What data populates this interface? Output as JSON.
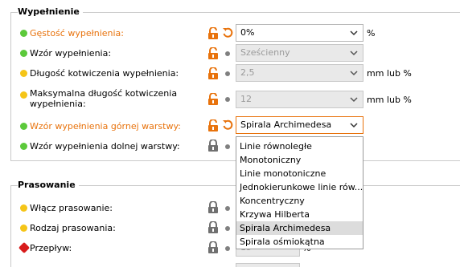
{
  "infill": {
    "title": "Wypełnienie",
    "rows": [
      {
        "label": "Gęstość wypełnienia:",
        "value": "0%",
        "unit": "%",
        "status": "green"
      },
      {
        "label": "Wzór wypełnienia:",
        "value": "Sześcienny",
        "unit": "",
        "status": "green"
      },
      {
        "label": "Długość kotwiczenia wypełnienia:",
        "value": "2,5",
        "unit": "mm lub %",
        "status": "yellow"
      },
      {
        "label": "Maksymalna długość kotwiczenia wypełnienia:",
        "value": "12",
        "unit": "mm lub %",
        "status": "yellow"
      },
      {
        "label": "Wzór wypełnienia górnej warstwy:",
        "value": "Spirala Archimedesa",
        "unit": "",
        "status": "green"
      },
      {
        "label": "Wzór wypełnienia dolnej warstwy:",
        "value": "",
        "unit": "",
        "status": "green"
      }
    ]
  },
  "dropdown": {
    "options": [
      "Linie równoległe",
      "Monotoniczny",
      "Linie monotoniczne",
      "Jednokierunkowe linie rów...",
      "Koncentryczny",
      "Krzywa Hilberta",
      "Spirala Archimedesa",
      "Spirala ośmiokątna"
    ],
    "selected": "Spirala Archimedesa"
  },
  "ironing": {
    "title": "Prasowanie",
    "rows": [
      {
        "label": "Włącz prasowanie:",
        "status": "yellow"
      },
      {
        "label": "Rodzaj prasowania:",
        "status": "yellow"
      },
      {
        "label": "Przepływ:",
        "value": "15",
        "unit": "%",
        "status": "red"
      }
    ]
  },
  "colors": {
    "accent": "#e8730d",
    "green": "#5cc93b",
    "yellow": "#f5c518",
    "red": "#d81b1b"
  }
}
